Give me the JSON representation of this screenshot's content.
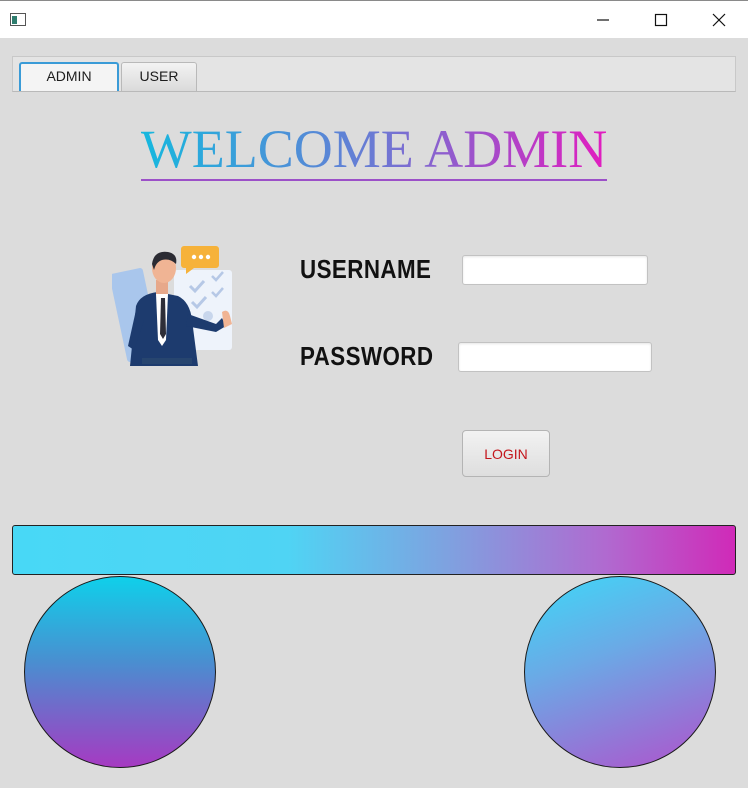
{
  "window": {
    "minimize_icon": "minimize-icon",
    "maximize_icon": "maximize-icon",
    "close_icon": "close-icon"
  },
  "tabs": [
    {
      "label": "ADMIN",
      "active": true
    },
    {
      "label": "USER",
      "active": false
    }
  ],
  "heading": "WELCOME ADMIN",
  "illustration": "businessman-illustration",
  "form": {
    "username_label": "USERNAME",
    "username_value": "",
    "password_label": "PASSWORD",
    "password_value": "",
    "login_label": "LOGIN"
  },
  "colors": {
    "gradient_start": "#16b8de",
    "gradient_end": "#e21cbf",
    "login_text": "#c4161c",
    "tab_active_border": "#3a9bd7"
  }
}
